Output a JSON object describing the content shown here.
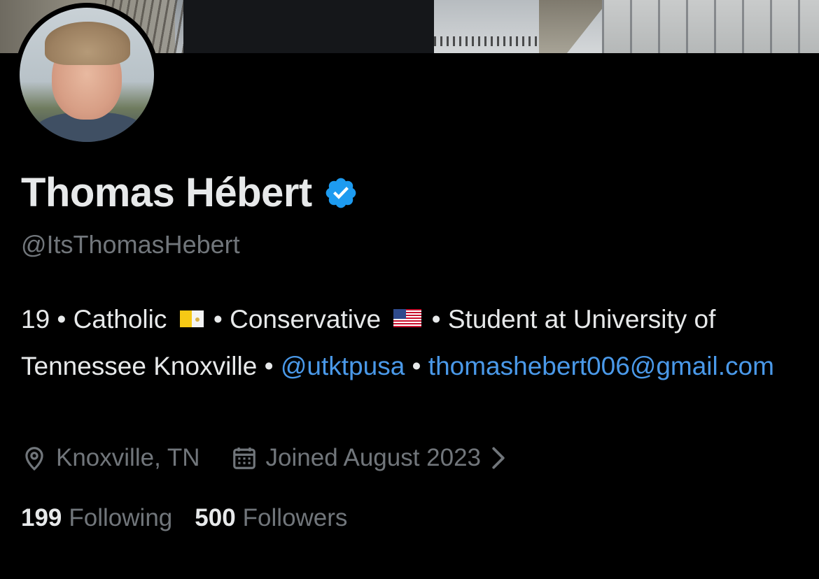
{
  "profile": {
    "display_name": "Thomas Hébert",
    "handle": "@ItsThomasHebert",
    "verified_color": "#1d9bf0"
  },
  "bio": {
    "line1_a": "19 • Catholic ",
    "line1_b": " • Conservative ",
    "line1_c": " • Student at University of Tennessee Knoxville • ",
    "mention": "@utktpusa",
    "separator": " • ",
    "email": "thomashebert006@gmail.com",
    "flag_1": "vatican-flag-icon",
    "flag_2": "us-flag-icon"
  },
  "meta": {
    "location": "Knoxville, TN",
    "joined": "Joined August 2023"
  },
  "stats": {
    "following_count": "199",
    "following_label": "Following",
    "followers_count": "500",
    "followers_label": "Followers"
  },
  "colors": {
    "background": "#000000",
    "text_primary": "#e7e9ea",
    "text_secondary": "#71767b",
    "link": "#4a99e9"
  }
}
